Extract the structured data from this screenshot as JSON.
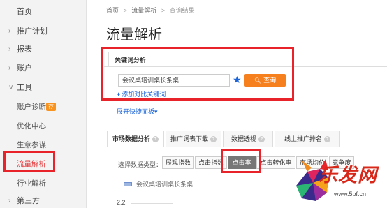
{
  "sidebar": {
    "items": [
      {
        "label": "首页",
        "chevron": ""
      },
      {
        "label": "推广计划",
        "chevron": "›"
      },
      {
        "label": "报表",
        "chevron": "›"
      },
      {
        "label": "账户",
        "chevron": "›"
      },
      {
        "label": "工具",
        "chevron": "∨"
      },
      {
        "label": "账户诊断",
        "chevron": "",
        "badge": "荐"
      },
      {
        "label": "优化中心",
        "chevron": ""
      },
      {
        "label": "生意参谋",
        "chevron": ""
      },
      {
        "label": "流量解析",
        "chevron": ""
      },
      {
        "label": "行业解析",
        "chevron": ""
      },
      {
        "label": "第三方",
        "chevron": "›"
      }
    ]
  },
  "breadcrumb": {
    "home": "首页",
    "sep": ">",
    "section": "流量解析",
    "current": "查询结果"
  },
  "page_title": "流量解析",
  "keyword_panel": {
    "tab_label": "关键词分析",
    "input_value": "会议桌培训桌长条桌",
    "query_button": "查询",
    "add_link": "添加对比关键词",
    "expand_link": "展开快捷面板▾"
  },
  "data_tabs": [
    {
      "label": "市场数据分析"
    },
    {
      "label": "推广词表下载"
    },
    {
      "label": "数据透视"
    },
    {
      "label": "线上推广排名"
    }
  ],
  "metrics": {
    "label": "选择数据类型：",
    "options": [
      "展现指数",
      "点击指数",
      "点击率",
      "点击转化率",
      "市场均价",
      "竞争度"
    ],
    "selected": "点击率"
  },
  "chart": {
    "legend": "会议桌培训桌长条桌",
    "y_tick": "2.2"
  },
  "watermark": {
    "text": "乐发网",
    "url": "www.5pf.cn"
  },
  "colors": {
    "accent": "#e4393c",
    "link": "#1a63d8",
    "button": "#f6801e",
    "highlight": "#e8232a"
  }
}
